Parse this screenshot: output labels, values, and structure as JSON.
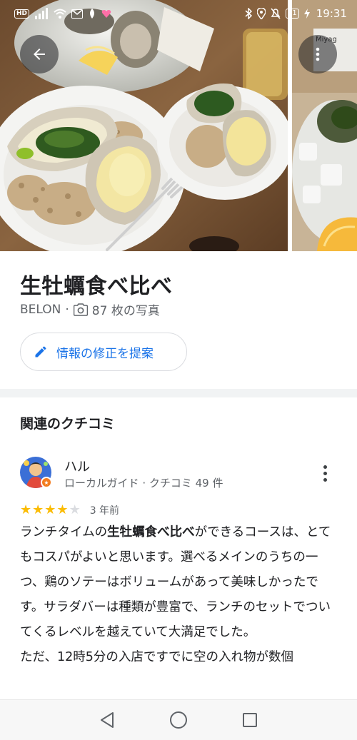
{
  "status_bar": {
    "hd_label": "HD",
    "battery": "81",
    "time": "19:31",
    "icons": [
      "signal-icon",
      "wifi-icon",
      "gmail-icon",
      "app-icon",
      "heart-icon",
      "bluetooth-icon",
      "location-icon",
      "mute-bell-icon",
      "charging-icon"
    ]
  },
  "photos": {
    "side_photo_caption": "Miyag"
  },
  "place": {
    "title": "生牡蠣食べ比べ",
    "restaurant": "BELON",
    "separator": "·",
    "photo_count": "87 枚の写真",
    "suggest_edit_label": "情報の修正を提案"
  },
  "reviews": {
    "heading": "関連のクチコミ",
    "items": [
      {
        "name": "ハル",
        "meta": "ローカルガイド · クチコミ 49 件",
        "rating": 4,
        "rating_max": 5,
        "time": "3 年前",
        "text_before": "ランチタイムの",
        "text_bold": "生牡蠣食べ比べ",
        "text_after": "ができるコースは、とてもコスパがよいと思います。選べるメインのうちの一つ、鶏のソテーはボリュームがあって美味しかったです。サラダバーは種類が豊富で、ランチのセットでついてくるレベルを越えていて大満足でした。",
        "text_line2": "ただ、12時5分の入店ですでに空の入れ物が数個"
      }
    ]
  },
  "colors": {
    "accent_blue": "#1a73e8",
    "star_yellow": "#fbbc04",
    "star_empty": "#dadce0",
    "text_primary": "#202124",
    "text_secondary": "#5f6368"
  }
}
